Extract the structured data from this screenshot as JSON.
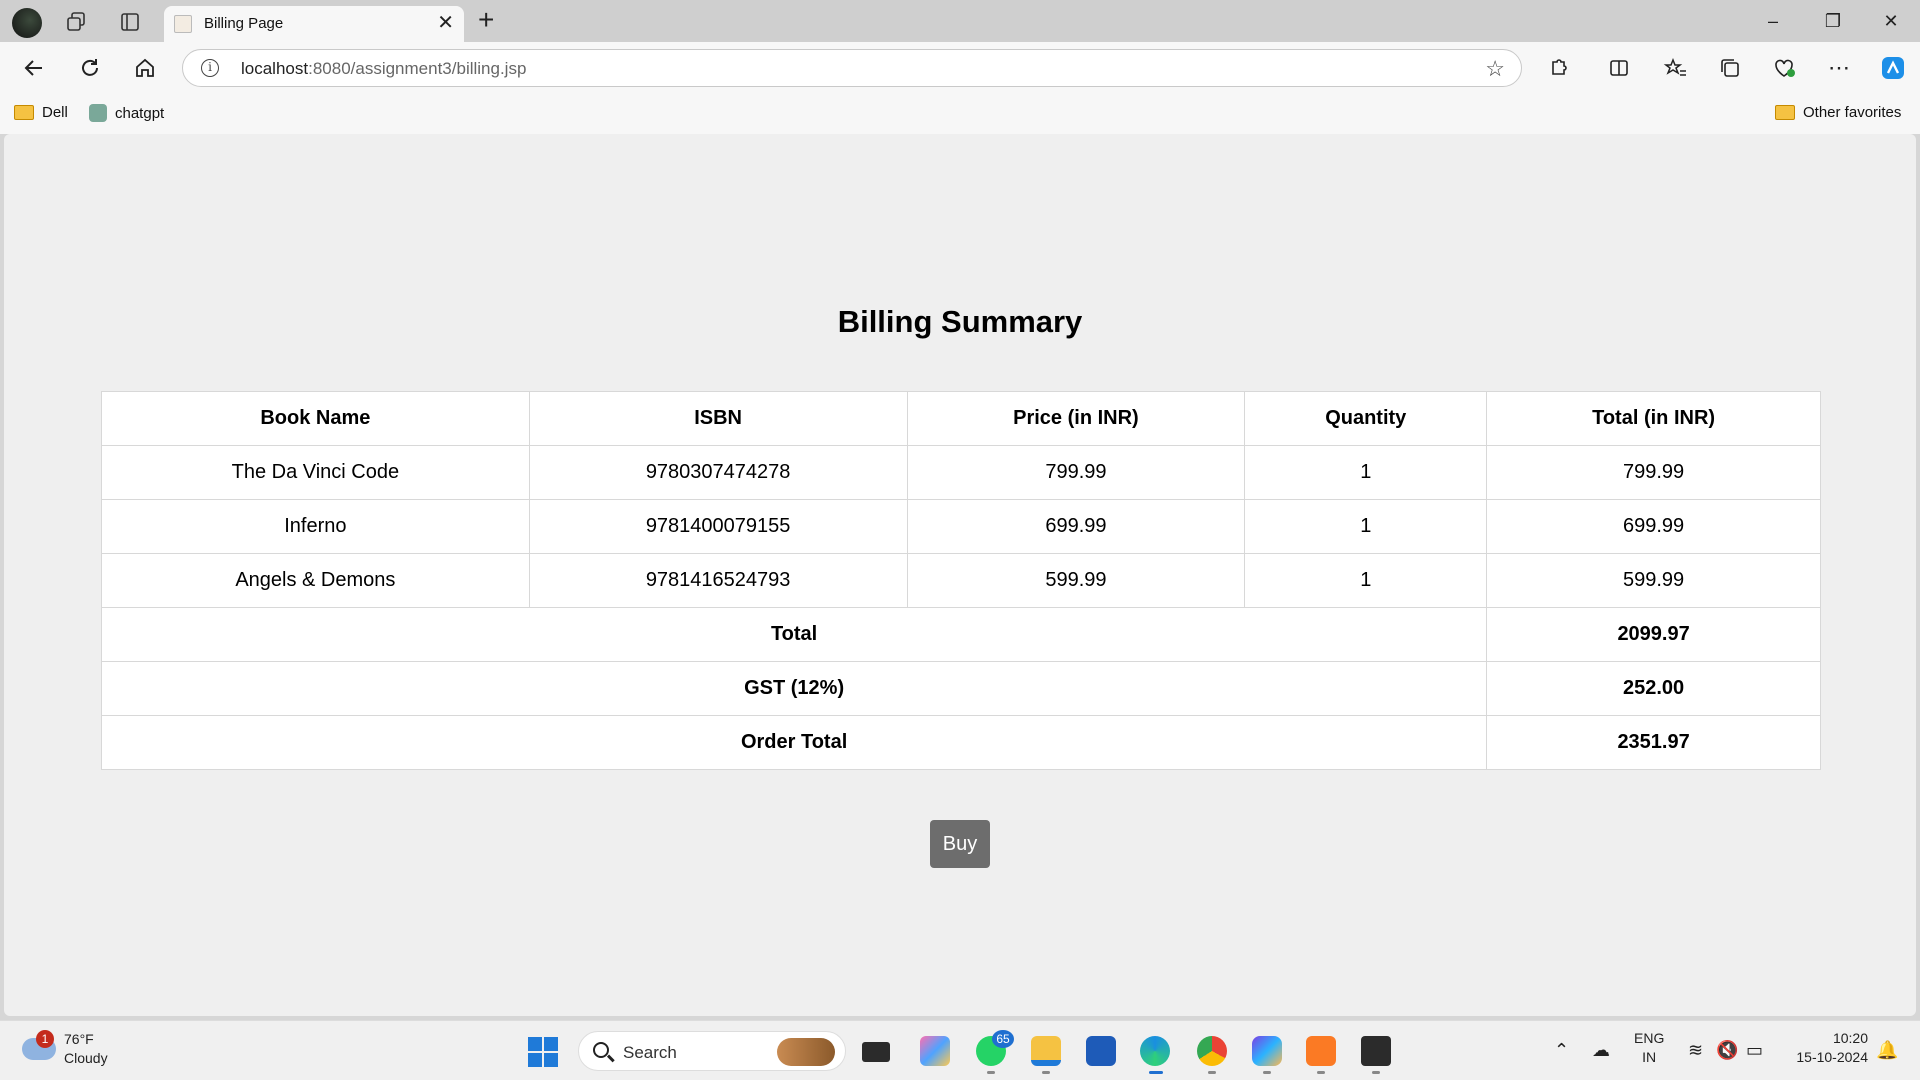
{
  "browser": {
    "tab_title": "Billing Page",
    "url_host": "localhost",
    "url_path": ":8080/assignment3/billing.jsp",
    "favorites": [
      "Dell",
      "chatgpt"
    ],
    "other_favorites": "Other favorites"
  },
  "page": {
    "title": "Billing Summary",
    "columns": [
      "Book Name",
      "ISBN",
      "Price (in INR)",
      "Quantity",
      "Total (in INR)"
    ],
    "rows": [
      {
        "name": "The Da Vinci Code",
        "isbn": "9780307474278",
        "price": "799.99",
        "qty": "1",
        "total": "799.99"
      },
      {
        "name": "Inferno",
        "isbn": "9781400079155",
        "price": "699.99",
        "qty": "1",
        "total": "699.99"
      },
      {
        "name": "Angels & Demons",
        "isbn": "9781416524793",
        "price": "599.99",
        "qty": "1",
        "total": "599.99"
      }
    ],
    "summary": [
      {
        "label": "Total",
        "value": "2099.97"
      },
      {
        "label": "GST (12%)",
        "value": "252.00"
      },
      {
        "label": "Order Total",
        "value": "2351.97"
      }
    ],
    "buy_label": "Buy"
  },
  "taskbar": {
    "weather_temp": "76°F",
    "weather_desc": "Cloudy",
    "weather_badge": "1",
    "search_label": "Search",
    "whatsapp_badge": "65",
    "lang_line1": "ENG",
    "lang_line2": "IN",
    "time": "10:20",
    "date": "15-10-2024"
  }
}
